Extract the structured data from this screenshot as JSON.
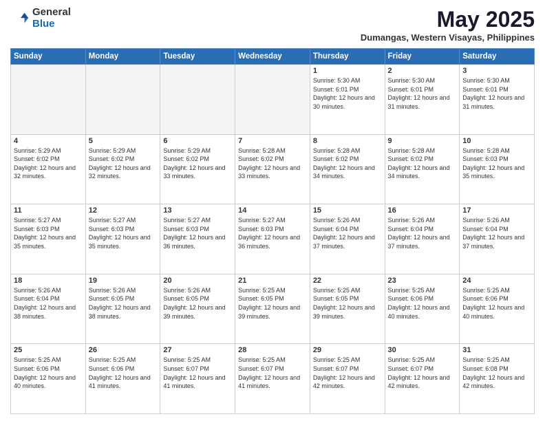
{
  "logo": {
    "general": "General",
    "blue": "Blue"
  },
  "title": "May 2025",
  "location": "Dumangas, Western Visayas, Philippines",
  "days_of_week": [
    "Sunday",
    "Monday",
    "Tuesday",
    "Wednesday",
    "Thursday",
    "Friday",
    "Saturday"
  ],
  "weeks": [
    [
      {
        "day": "",
        "info": ""
      },
      {
        "day": "",
        "info": ""
      },
      {
        "day": "",
        "info": ""
      },
      {
        "day": "",
        "info": ""
      },
      {
        "day": "1",
        "info": "Sunrise: 5:30 AM\nSunset: 6:01 PM\nDaylight: 12 hours and 30 minutes."
      },
      {
        "day": "2",
        "info": "Sunrise: 5:30 AM\nSunset: 6:01 PM\nDaylight: 12 hours and 31 minutes."
      },
      {
        "day": "3",
        "info": "Sunrise: 5:30 AM\nSunset: 6:01 PM\nDaylight: 12 hours and 31 minutes."
      }
    ],
    [
      {
        "day": "4",
        "info": "Sunrise: 5:29 AM\nSunset: 6:02 PM\nDaylight: 12 hours and 32 minutes."
      },
      {
        "day": "5",
        "info": "Sunrise: 5:29 AM\nSunset: 6:02 PM\nDaylight: 12 hours and 32 minutes."
      },
      {
        "day": "6",
        "info": "Sunrise: 5:29 AM\nSunset: 6:02 PM\nDaylight: 12 hours and 33 minutes."
      },
      {
        "day": "7",
        "info": "Sunrise: 5:28 AM\nSunset: 6:02 PM\nDaylight: 12 hours and 33 minutes."
      },
      {
        "day": "8",
        "info": "Sunrise: 5:28 AM\nSunset: 6:02 PM\nDaylight: 12 hours and 34 minutes."
      },
      {
        "day": "9",
        "info": "Sunrise: 5:28 AM\nSunset: 6:02 PM\nDaylight: 12 hours and 34 minutes."
      },
      {
        "day": "10",
        "info": "Sunrise: 5:28 AM\nSunset: 6:03 PM\nDaylight: 12 hours and 35 minutes."
      }
    ],
    [
      {
        "day": "11",
        "info": "Sunrise: 5:27 AM\nSunset: 6:03 PM\nDaylight: 12 hours and 35 minutes."
      },
      {
        "day": "12",
        "info": "Sunrise: 5:27 AM\nSunset: 6:03 PM\nDaylight: 12 hours and 35 minutes."
      },
      {
        "day": "13",
        "info": "Sunrise: 5:27 AM\nSunset: 6:03 PM\nDaylight: 12 hours and 36 minutes."
      },
      {
        "day": "14",
        "info": "Sunrise: 5:27 AM\nSunset: 6:03 PM\nDaylight: 12 hours and 36 minutes."
      },
      {
        "day": "15",
        "info": "Sunrise: 5:26 AM\nSunset: 6:04 PM\nDaylight: 12 hours and 37 minutes."
      },
      {
        "day": "16",
        "info": "Sunrise: 5:26 AM\nSunset: 6:04 PM\nDaylight: 12 hours and 37 minutes."
      },
      {
        "day": "17",
        "info": "Sunrise: 5:26 AM\nSunset: 6:04 PM\nDaylight: 12 hours and 37 minutes."
      }
    ],
    [
      {
        "day": "18",
        "info": "Sunrise: 5:26 AM\nSunset: 6:04 PM\nDaylight: 12 hours and 38 minutes."
      },
      {
        "day": "19",
        "info": "Sunrise: 5:26 AM\nSunset: 6:05 PM\nDaylight: 12 hours and 38 minutes."
      },
      {
        "day": "20",
        "info": "Sunrise: 5:26 AM\nSunset: 6:05 PM\nDaylight: 12 hours and 39 minutes."
      },
      {
        "day": "21",
        "info": "Sunrise: 5:25 AM\nSunset: 6:05 PM\nDaylight: 12 hours and 39 minutes."
      },
      {
        "day": "22",
        "info": "Sunrise: 5:25 AM\nSunset: 6:05 PM\nDaylight: 12 hours and 39 minutes."
      },
      {
        "day": "23",
        "info": "Sunrise: 5:25 AM\nSunset: 6:06 PM\nDaylight: 12 hours and 40 minutes."
      },
      {
        "day": "24",
        "info": "Sunrise: 5:25 AM\nSunset: 6:06 PM\nDaylight: 12 hours and 40 minutes."
      }
    ],
    [
      {
        "day": "25",
        "info": "Sunrise: 5:25 AM\nSunset: 6:06 PM\nDaylight: 12 hours and 40 minutes."
      },
      {
        "day": "26",
        "info": "Sunrise: 5:25 AM\nSunset: 6:06 PM\nDaylight: 12 hours and 41 minutes."
      },
      {
        "day": "27",
        "info": "Sunrise: 5:25 AM\nSunset: 6:07 PM\nDaylight: 12 hours and 41 minutes."
      },
      {
        "day": "28",
        "info": "Sunrise: 5:25 AM\nSunset: 6:07 PM\nDaylight: 12 hours and 41 minutes."
      },
      {
        "day": "29",
        "info": "Sunrise: 5:25 AM\nSunset: 6:07 PM\nDaylight: 12 hours and 42 minutes."
      },
      {
        "day": "30",
        "info": "Sunrise: 5:25 AM\nSunset: 6:07 PM\nDaylight: 12 hours and 42 minutes."
      },
      {
        "day": "31",
        "info": "Sunrise: 5:25 AM\nSunset: 6:08 PM\nDaylight: 12 hours and 42 minutes."
      }
    ]
  ]
}
